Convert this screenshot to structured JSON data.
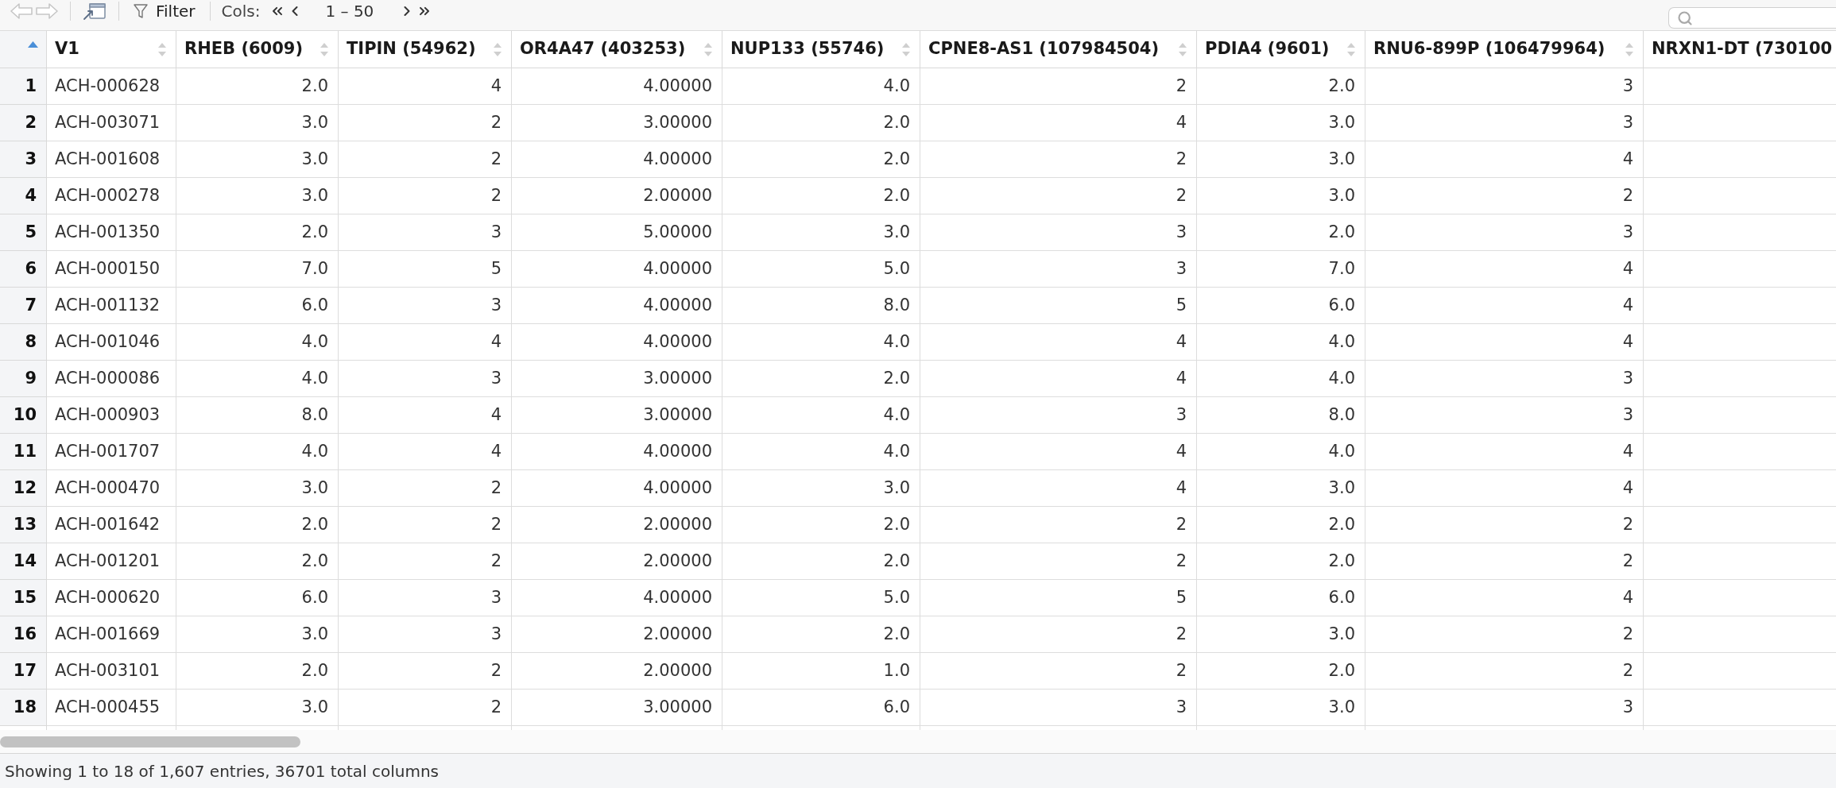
{
  "toolbar": {
    "history": [
      {
        "kind": "back",
        "disabled": true
      },
      {
        "kind": "forward",
        "disabled": true
      }
    ],
    "filter_button": {
      "label": "Filter"
    },
    "columns_pager": {
      "label": "Cols:",
      "range": "1 – 50"
    }
  },
  "table": {
    "index_header": {
      "sorted": true
    },
    "columns": [
      {
        "label": "V1",
        "kind": "text",
        "sorted": false
      },
      {
        "label": "RHEB (6009)",
        "kind": "number",
        "sorted": false
      },
      {
        "label": "TIPIN (54962)",
        "kind": "number",
        "sorted": false
      },
      {
        "label": "OR4A47 (403253)",
        "kind": "number",
        "sorted": false
      },
      {
        "label": "NUP133 (55746)",
        "kind": "number",
        "sorted": false
      },
      {
        "label": "CPNE8-AS1 (107984504)",
        "kind": "number",
        "sorted": false
      },
      {
        "label": "PDIA4 (9601)",
        "kind": "number",
        "sorted": false
      },
      {
        "label": "RNU6-899P (106479964)",
        "kind": "number",
        "sorted": false
      },
      {
        "label": "NRXN1-DT (730100",
        "kind": "number"
      }
    ],
    "rows": [
      {
        "index": "1",
        "cells": [
          "ACH-000628",
          "2.0",
          "4",
          "4.00000",
          "4.0",
          "2",
          "2.0",
          "3"
        ]
      },
      {
        "index": "2",
        "cells": [
          "ACH-003071",
          "3.0",
          "2",
          "3.00000",
          "2.0",
          "4",
          "3.0",
          "3"
        ]
      },
      {
        "index": "3",
        "cells": [
          "ACH-001608",
          "3.0",
          "2",
          "4.00000",
          "2.0",
          "2",
          "3.0",
          "4"
        ]
      },
      {
        "index": "4",
        "cells": [
          "ACH-000278",
          "3.0",
          "2",
          "2.00000",
          "2.0",
          "2",
          "3.0",
          "2"
        ]
      },
      {
        "index": "5",
        "cells": [
          "ACH-001350",
          "2.0",
          "3",
          "5.00000",
          "3.0",
          "3",
          "2.0",
          "3"
        ]
      },
      {
        "index": "6",
        "cells": [
          "ACH-000150",
          "7.0",
          "5",
          "4.00000",
          "5.0",
          "3",
          "7.0",
          "4"
        ]
      },
      {
        "index": "7",
        "cells": [
          "ACH-001132",
          "6.0",
          "3",
          "4.00000",
          "8.0",
          "5",
          "6.0",
          "4"
        ]
      },
      {
        "index": "8",
        "cells": [
          "ACH-001046",
          "4.0",
          "4",
          "4.00000",
          "4.0",
          "4",
          "4.0",
          "4"
        ]
      },
      {
        "index": "9",
        "cells": [
          "ACH-000086",
          "4.0",
          "3",
          "3.00000",
          "2.0",
          "4",
          "4.0",
          "3"
        ]
      },
      {
        "index": "10",
        "cells": [
          "ACH-000903",
          "8.0",
          "4",
          "3.00000",
          "4.0",
          "3",
          "8.0",
          "3"
        ]
      },
      {
        "index": "11",
        "cells": [
          "ACH-001707",
          "4.0",
          "4",
          "4.00000",
          "4.0",
          "4",
          "4.0",
          "4"
        ]
      },
      {
        "index": "12",
        "cells": [
          "ACH-000470",
          "3.0",
          "2",
          "4.00000",
          "3.0",
          "4",
          "3.0",
          "4"
        ]
      },
      {
        "index": "13",
        "cells": [
          "ACH-001642",
          "2.0",
          "2",
          "2.00000",
          "2.0",
          "2",
          "2.0",
          "2"
        ]
      },
      {
        "index": "14",
        "cells": [
          "ACH-001201",
          "2.0",
          "2",
          "2.00000",
          "2.0",
          "2",
          "2.0",
          "2"
        ]
      },
      {
        "index": "15",
        "cells": [
          "ACH-000620",
          "6.0",
          "3",
          "4.00000",
          "5.0",
          "5",
          "6.0",
          "4"
        ]
      },
      {
        "index": "16",
        "cells": [
          "ACH-001669",
          "3.0",
          "3",
          "2.00000",
          "2.0",
          "2",
          "3.0",
          "2"
        ]
      },
      {
        "index": "17",
        "cells": [
          "ACH-003101",
          "2.0",
          "2",
          "2.00000",
          "1.0",
          "2",
          "2.0",
          "2"
        ]
      },
      {
        "index": "18",
        "cells": [
          "ACH-000455",
          "3.0",
          "2",
          "3.00000",
          "6.0",
          "3",
          "3.0",
          "3"
        ]
      }
    ]
  },
  "status_bar": {
    "text": "Showing 1 to 18 of 1,607 entries, 36701 total columns"
  }
}
